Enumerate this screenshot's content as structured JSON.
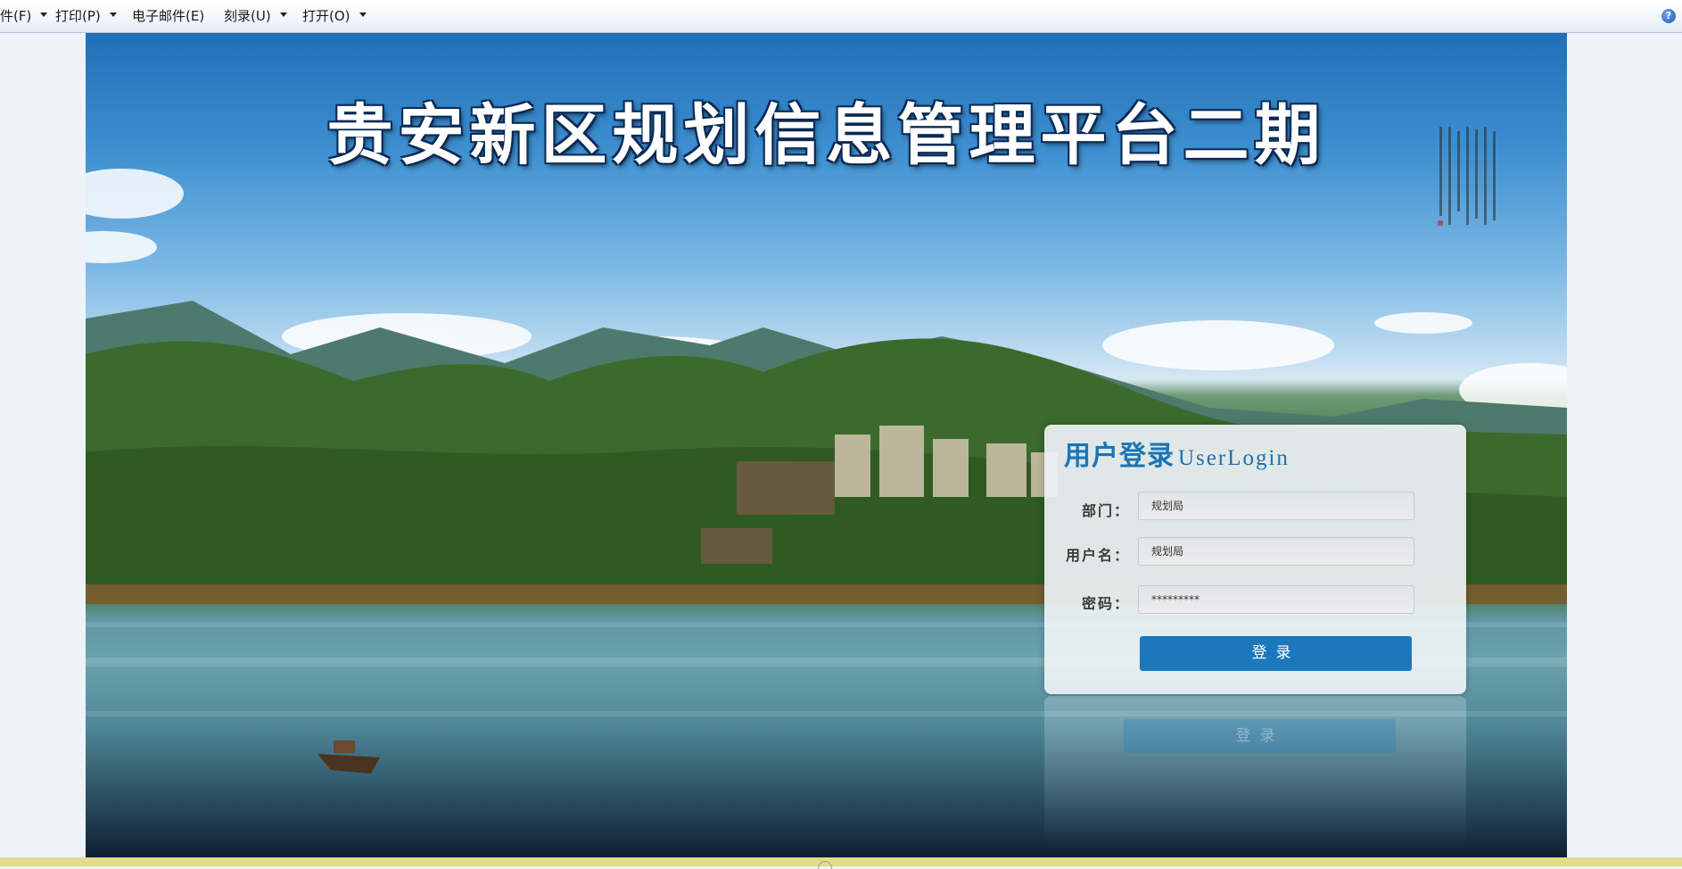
{
  "toolbar": {
    "items": [
      {
        "label": "件(F)"
      },
      {
        "label": "打印(P)"
      },
      {
        "label": "电子邮件(E)"
      },
      {
        "label": "刻录(U)"
      },
      {
        "label": "打开(O)"
      }
    ],
    "help_icon": "help-icon",
    "help_glyph": "?"
  },
  "page": {
    "title": "贵安新区规划信息管理平台二期"
  },
  "login": {
    "title_cn": "用户登录",
    "title_en": "UserLogin",
    "department_label": "部门：",
    "department_value": "规划局",
    "username_label": "用户名：",
    "username_value": "规划局",
    "password_label": "密码：",
    "password_value": "*********",
    "button_label": "登录",
    "reflection_label": "登录"
  },
  "colors": {
    "accent": "#1c77bb",
    "title_blue": "#1c74b6",
    "status_strip": "#e3dc8a"
  }
}
